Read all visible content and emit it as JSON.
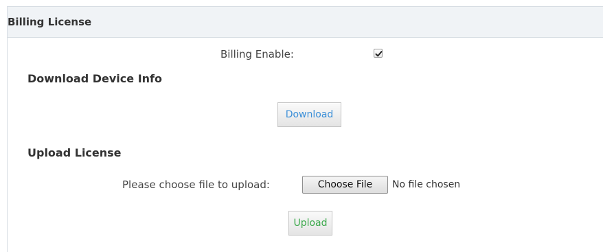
{
  "panel": {
    "title": "Billing License"
  },
  "billing": {
    "enable_label": "Billing Enable:",
    "enabled": true
  },
  "download_section": {
    "title": "Download Device Info",
    "button_label": "Download"
  },
  "upload_section": {
    "title": "Upload License",
    "file_prompt": "Please choose file to upload:",
    "choose_file_label": "Choose File",
    "file_status": "No file chosen",
    "button_label": "Upload"
  },
  "colors": {
    "header_bg": "#f0f3f6",
    "border": "#d7dde3",
    "download_text": "#3b8fd8",
    "upload_text": "#3aa84a"
  },
  "icons": {
    "checkbox_mark": "checkmark-icon"
  }
}
